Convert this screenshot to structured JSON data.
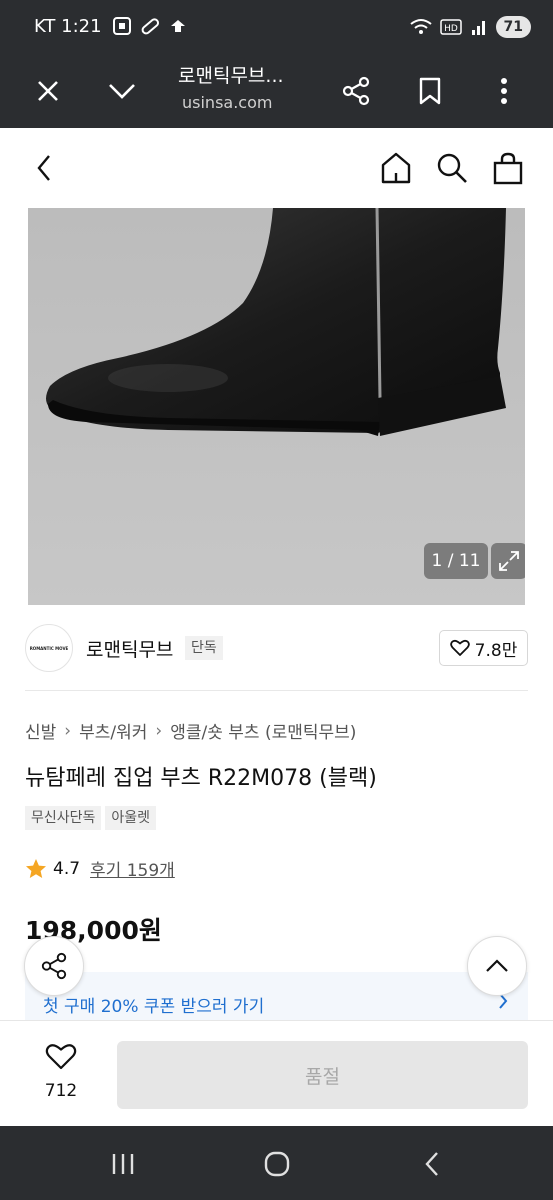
{
  "status_bar": {
    "carrier_time": "KT 1:21",
    "battery": "71",
    "icons": [
      "screen-record-icon",
      "link-icon",
      "notification-icon",
      "wifi-icon",
      "hd-icon",
      "signal-icon"
    ]
  },
  "browser": {
    "title": "로맨틱무브...",
    "url": "usinsa.com",
    "icons": [
      "close-icon",
      "chevron-down-icon",
      "share-icon",
      "bookmark-icon",
      "more-icon"
    ]
  },
  "header": {
    "icons": [
      "back-icon",
      "home-icon",
      "search-icon",
      "cart-icon"
    ]
  },
  "gallery": {
    "counter": "1 / 11"
  },
  "brand": {
    "logo_text": "ROMANTIC MOVE",
    "name": "로맨틱무브",
    "tag": "단독",
    "likes": "7.8만"
  },
  "breadcrumb": [
    "신발",
    "부츠/워커",
    "앵클/숏 부츠 (로맨틱무브)"
  ],
  "product": {
    "title": "뉴탐페레 집업 부츠 R22M078 (블랙)",
    "tags": [
      "무신사단독",
      "아울렛"
    ],
    "rating": "4.7",
    "reviews": "후기 159개",
    "price": "198,000원"
  },
  "coupon": {
    "text": "첫 구매 20% 쿠폰 받으러 가기"
  },
  "purchase": {
    "wish_count": "712",
    "button": "품절"
  },
  "colors": {
    "system_bar": "#2b2d30",
    "star": "#f5a623",
    "coupon_text": "#1f6fcf",
    "coupon_bg": "#f3f7fc",
    "soldout_bg": "#e6e6e6"
  }
}
